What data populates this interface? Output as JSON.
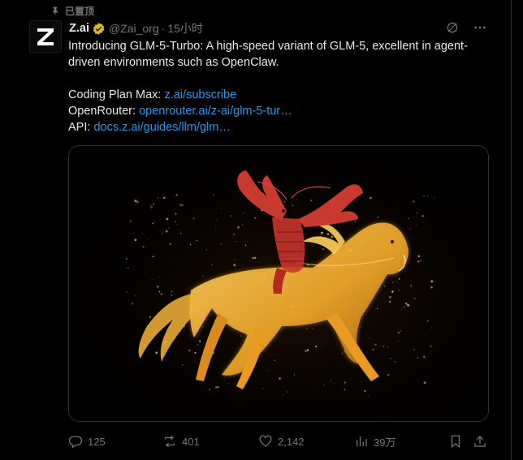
{
  "pinned": {
    "label": "已置顶",
    "icon": "pin-icon"
  },
  "author": {
    "display_name": "Z.ai",
    "handle": "@Zai_org",
    "time": "15小时",
    "separator": "·",
    "avatar_icon": "z-logo-icon",
    "verified_icon": "verified-badge-icon"
  },
  "header_actions": {
    "grok_icon": "grok-icon",
    "more_icon": "more-icon"
  },
  "body": {
    "line1": "Introducing GLM-5-Turbo: A high-speed variant of GLM-5, excellent in agent-driven environments such as OpenClaw.",
    "coding_plan_label": "Coding Plan Max: ",
    "coding_plan_link": "z.ai/subscribe",
    "openrouter_label": "OpenRouter: ",
    "openrouter_link": "openrouter.ai/z-ai/glm-5-tur…",
    "api_label": "API: ",
    "api_link": "docs.z.ai/guides/llm/glm…"
  },
  "media": {
    "icon": "lobster-riding-horse-image"
  },
  "actions": {
    "replies": "125",
    "reposts": "401",
    "likes": "2,142",
    "views": "39万",
    "reply_icon": "reply-icon",
    "repost_icon": "repost-icon",
    "like_icon": "like-icon",
    "views_icon": "views-icon",
    "bookmark_icon": "bookmark-icon",
    "share_icon": "share-icon"
  },
  "colors": {
    "background": "#000000",
    "text": "#e7e9ea",
    "muted": "#71767b",
    "link": "#1d9bf0",
    "verified_gold": "#e2b719",
    "horse_gold": "#f5b83a",
    "lobster_red": "#c8342d"
  }
}
